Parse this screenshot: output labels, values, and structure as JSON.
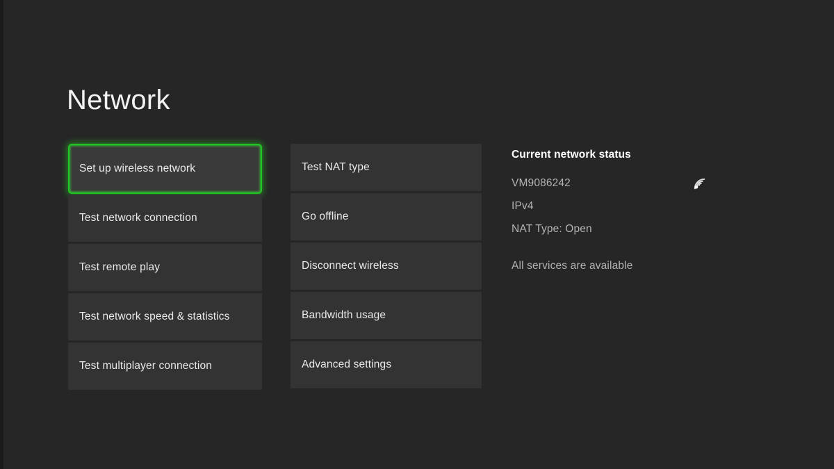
{
  "page": {
    "title": "Network",
    "background_color": "#262626",
    "tile_color": "#333333",
    "focus_color": "#21c521"
  },
  "menu": {
    "column_1": [
      {
        "label": "Set up wireless network",
        "focused": true
      },
      {
        "label": "Test network connection",
        "focused": false
      },
      {
        "label": "Test remote play",
        "focused": false
      },
      {
        "label": "Test network speed & statistics",
        "focused": false
      },
      {
        "label": "Test multiplayer connection",
        "focused": false
      }
    ],
    "column_2": [
      {
        "label": "Test NAT type",
        "focused": false
      },
      {
        "label": "Go offline",
        "focused": false
      },
      {
        "label": "Disconnect wireless",
        "focused": false
      },
      {
        "label": "Bandwidth usage",
        "focused": false
      },
      {
        "label": "Advanced settings",
        "focused": false
      }
    ]
  },
  "status": {
    "heading": "Current network status",
    "network_name": "VM9086242",
    "ip_version": "IPv4",
    "nat_type": "NAT Type: Open",
    "services": "All services are available",
    "wifi_icon": "wifi-icon"
  }
}
